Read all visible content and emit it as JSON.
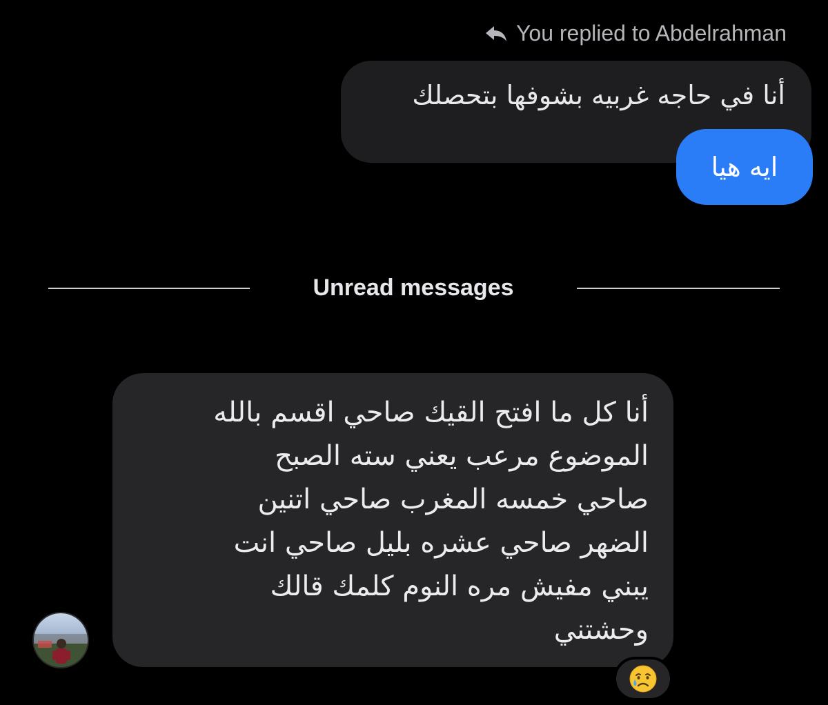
{
  "reply_header": {
    "text": "You replied to Abdelrahman",
    "icon": "reply-arrow-icon"
  },
  "quoted_message": {
    "text": "أنا في حاجه غربيه بشوفها بتحصلك"
  },
  "sent_message": {
    "text": "ايه هيا"
  },
  "divider": {
    "label": "Unread messages"
  },
  "received_message": {
    "lines": [
      "أنا كل ما افتح القيك صاحي اقسم بالله",
      "الموضوع مرعب يعني سته الصبح",
      "صاحي خمسه المغرب صاحي اتنين",
      "الضهر صاحي عشره بليل صاحي انت",
      "يبني مفيش مره النوم كلمك قالك",
      "وحشتني"
    ]
  },
  "reaction": {
    "emoji": "crying-face-icon"
  },
  "colors": {
    "background": "#000000",
    "sent_bubble": "#2b7cf7",
    "received_bubble": "#262628",
    "quoted_bubble": "#1e1e20",
    "secondary_text": "#b5b5ba"
  }
}
